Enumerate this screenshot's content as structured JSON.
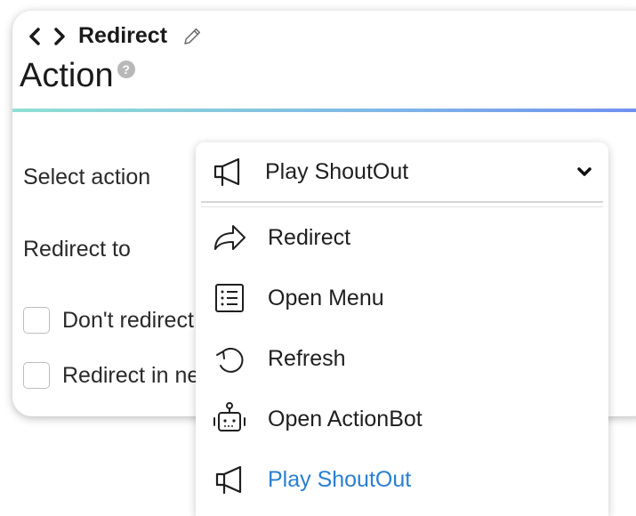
{
  "header": {
    "nav_title": "Redirect",
    "page_title": "Action",
    "help_symbol": "?"
  },
  "form": {
    "select_action_label": "Select action",
    "redirect_to_label": "Redirect to",
    "checkbox1_label": "Don't redirect",
    "checkbox2_label": "Redirect in new window"
  },
  "dropdown": {
    "selected": "Play ShoutOut",
    "selected_icon": "megaphone-icon",
    "options": [
      {
        "label": "Redirect",
        "icon": "share-arrow-icon"
      },
      {
        "label": "Open Menu",
        "icon": "list-icon"
      },
      {
        "label": "Refresh",
        "icon": "refresh-icon"
      },
      {
        "label": "Open ActionBot",
        "icon": "robot-icon"
      },
      {
        "label": "Play ShoutOut",
        "icon": "megaphone-icon"
      }
    ],
    "active_option": "Play ShoutOut",
    "active_color": "#2a7fd1"
  },
  "colors": {
    "divider_gradient_start": "#8fe0d4",
    "divider_gradient_end": "#6f8ff0"
  }
}
